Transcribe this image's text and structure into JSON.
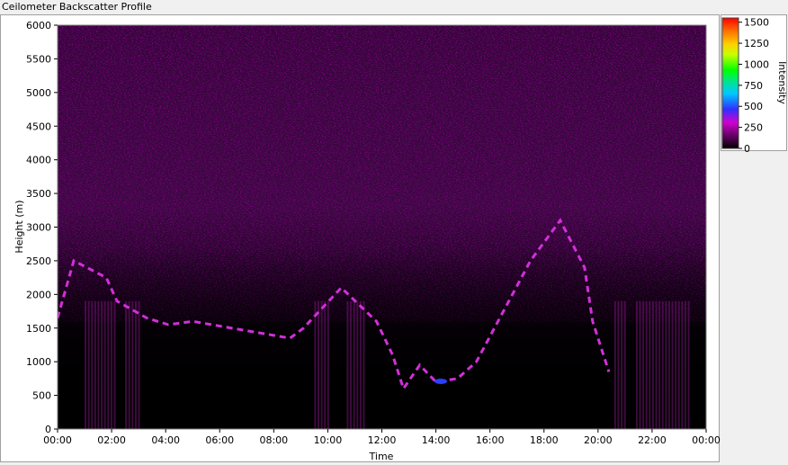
{
  "window": {
    "title": "Ceilometer Backscatter Profile"
  },
  "chart_data": {
    "type": "heatmap",
    "title": "Ceilometer Backscatter Profile",
    "xlabel": "Time",
    "ylabel": "Height (m)",
    "x_ticks": [
      "00:00",
      "02:00",
      "04:00",
      "06:00",
      "08:00",
      "10:00",
      "12:00",
      "14:00",
      "16:00",
      "18:00",
      "20:00",
      "22:00",
      "00:00"
    ],
    "xlim_hours": [
      0,
      24
    ],
    "ylim": [
      0,
      6000
    ],
    "y_ticks": [
      0,
      500,
      1000,
      1500,
      2000,
      2500,
      3000,
      3500,
      4000,
      4500,
      5000,
      5500,
      6000
    ],
    "grid": false,
    "colorbar": {
      "label": "Intensity",
      "ticks": [
        0,
        250,
        500,
        750,
        1000,
        1250,
        1500
      ],
      "range": [
        0,
        1550
      ],
      "colors": [
        "#000000",
        "#c000c0",
        "#0000ff",
        "#00e0e0",
        "#00ff00",
        "#ffff00",
        "#ff8000",
        "#ff0000"
      ]
    },
    "cloud_layer": {
      "description_units": "time in hours, height in m",
      "points": [
        {
          "t": 0.0,
          "h": 1650
        },
        {
          "t": 0.6,
          "h": 2500
        },
        {
          "t": 1.8,
          "h": 2250
        },
        {
          "t": 2.2,
          "h": 1900
        },
        {
          "t": 3.3,
          "h": 1650
        },
        {
          "t": 4.1,
          "h": 1550
        },
        {
          "t": 5.0,
          "h": 1600
        },
        {
          "t": 8.6,
          "h": 1350
        },
        {
          "t": 9.1,
          "h": 1500
        },
        {
          "t": 10.5,
          "h": 2100
        },
        {
          "t": 11.8,
          "h": 1600
        },
        {
          "t": 12.4,
          "h": 1100
        },
        {
          "t": 12.8,
          "h": 600
        },
        {
          "t": 13.4,
          "h": 950
        },
        {
          "t": 14.0,
          "h": 700
        },
        {
          "t": 14.8,
          "h": 750
        },
        {
          "t": 15.5,
          "h": 1000
        },
        {
          "t": 17.5,
          "h": 2500
        },
        {
          "t": 18.6,
          "h": 3100
        },
        {
          "t": 19.5,
          "h": 2400
        },
        {
          "t": 19.8,
          "h": 1600
        },
        {
          "t": 20.4,
          "h": 850
        }
      ]
    }
  }
}
